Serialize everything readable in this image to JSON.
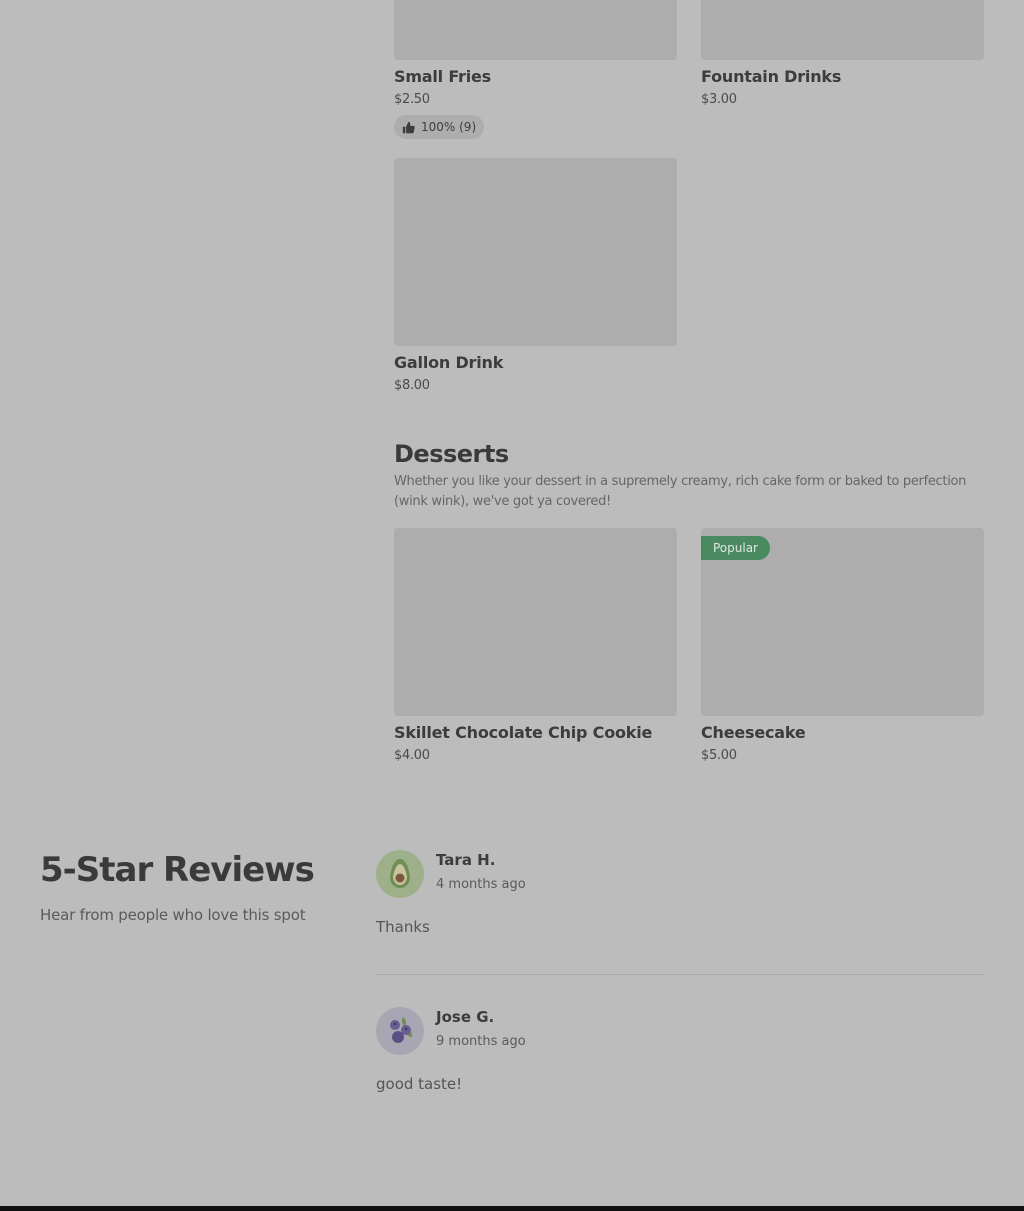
{
  "menu": {
    "items": [
      {
        "name": "Small Fries",
        "price": "$2.50",
        "rating": "100% (9)"
      },
      {
        "name": "Fountain Drinks",
        "price": "$3.00"
      },
      {
        "name": "Gallon Drink",
        "price": "$8.00"
      }
    ],
    "desserts": {
      "title": "Desserts",
      "description": "Whether you like your dessert in a supremely creamy, rich cake form or baked to perfection (wink wink), we've got ya covered!",
      "items": [
        {
          "name": "Skillet Chocolate Chip Cookie",
          "price": "$4.00"
        },
        {
          "name": "Cheesecake",
          "price": "$5.00",
          "badge": "Popular"
        }
      ]
    }
  },
  "reviews": {
    "title": "5-Star Reviews",
    "subtitle": "Hear from people who love this spot",
    "list": [
      {
        "name": "Tara H.",
        "date": "4 months ago",
        "text": "Thanks",
        "avatar_icon": "avocado-icon"
      },
      {
        "name": "Jose G.",
        "date": "9 months ago",
        "text": "good taste!",
        "avatar_icon": "blueberries-icon"
      }
    ]
  },
  "colors": {
    "popular_badge": "#4a8a61"
  }
}
